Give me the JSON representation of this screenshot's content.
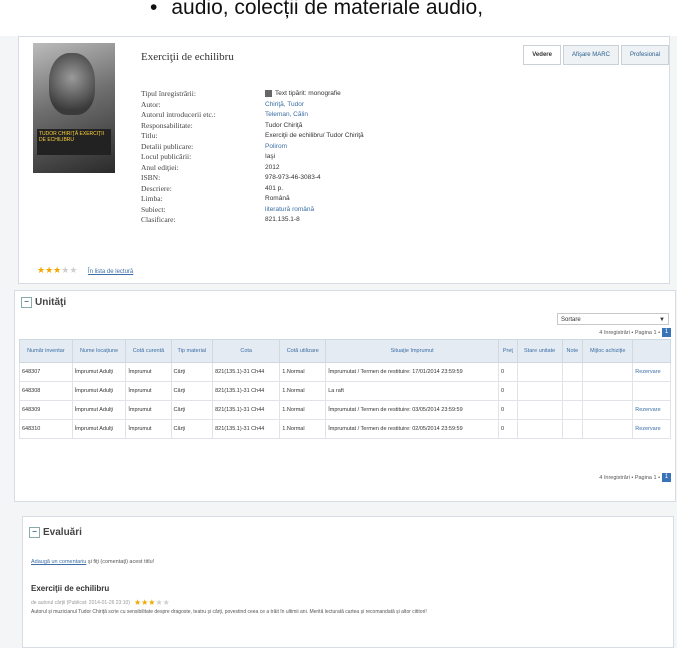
{
  "bullet": "audio, colecții de materiale audio,",
  "record": {
    "title": "Exerciţii de echilibru",
    "view_tabs": [
      "Vedere",
      "Afişare MARC",
      "Profesional"
    ],
    "fields": [
      {
        "label": "Tipul înregistrării:",
        "value": "Text tipărit: monografie",
        "link": false,
        "icon": "text-type-icon"
      },
      {
        "label": "Autor:",
        "value": "Chiriţă, Tudor",
        "link": true
      },
      {
        "label": "Autorul introducerii etc.:",
        "value": "Teleman, Călin",
        "link": true
      },
      {
        "label": "Responsabilitate:",
        "value": "Tudor Chiriţă",
        "link": false
      },
      {
        "label": "Titlu:",
        "value": "Exerciţii de echilibru/ Tudor Chiriţă",
        "link": false
      },
      {
        "label": "Detalii publicare:",
        "value": "Polirom",
        "link": true
      },
      {
        "label": "Locul publicării:",
        "value": "Iaşi",
        "link": false
      },
      {
        "label": "Anul ediţiei:",
        "value": "2012",
        "link": false
      },
      {
        "label": "ISBN:",
        "value": "978-973-46-3083-4",
        "link": false
      },
      {
        "label": "Descriere:",
        "value": "401 p.",
        "link": false
      },
      {
        "label": "Limba:",
        "value": "Română",
        "link": false
      },
      {
        "label": "Subiect:",
        "value": "literatură română",
        "link": true
      },
      {
        "label": "Clasificare:",
        "value": "821.135.1-8",
        "link": false
      }
    ],
    "cover_text": "TUDOR CHIRIŢĂ EXERCIŢII DE ECHILIBRU",
    "rating": 3,
    "rating_max": 5,
    "rating_link": "În lista de lectură"
  },
  "units": {
    "title": "Unităţi",
    "sort_select": "Sortare",
    "pager_text": "4 înregistrări • Pagina 1 •",
    "pager_button": "1",
    "columns": [
      "Număr inventar",
      "Nume locaţiune",
      "Cotă curentă",
      "Tip material",
      "Cota",
      "Cotă utilizare",
      "Situaţie împrumut",
      "Preţ",
      "Stare unitate",
      "Note",
      "Mijloc achiziţie",
      ""
    ],
    "rows": [
      [
        "648307",
        "Împrumut Adulţi",
        "Împrumut",
        "Cărţi",
        "821(135.1)-31 Ch44",
        "1.Normal",
        "Împrumutat / Termen de restituire: 17/01/2014 23:59:59",
        "0",
        "",
        "",
        "",
        "Rezervare"
      ],
      [
        "648308",
        "Împrumut Adulţi",
        "Împrumut",
        "Cărţi",
        "821(135.1)-31 Ch44",
        "1.Normal",
        "La raft",
        "0",
        "",
        "",
        "",
        ""
      ],
      [
        "648309",
        "Împrumut Adulţi",
        "Împrumut",
        "Cărţi",
        "821(135.1)-31 Ch44",
        "1.Normal",
        "Împrumutat / Termen de restituire: 03/05/2014 23:59:59",
        "0",
        "",
        "",
        "",
        "Rezervare"
      ],
      [
        "648310",
        "Împrumut Adulţi",
        "Împrumut",
        "Cărţi",
        "821(135.1)-31 Ch44",
        "1.Normal",
        "Împrumutat / Termen de restituire: 02/05/2014 23:59:59",
        "0",
        "",
        "",
        "",
        "Rezervare"
      ]
    ]
  },
  "evals": {
    "title": "Evaluări",
    "add_link": "Adaugă un comentariu",
    "add_rest": " şi fiţi (comentaţi) acest titlu!",
    "item_title": "Exerciţii de echilibru",
    "item_meta": "de autorul cărţii (Publicat: 2014-01-26 23:10)",
    "item_stars": 3,
    "item_text": "Autorul și muzicianul Tudor Chiriţă scrie cu sensibilitate despre dragoste, teatru și cărţi, povestind ceea ce a trăit în ultimii ani. Merită lecturată cartea și recomandată și altor cititori!"
  }
}
